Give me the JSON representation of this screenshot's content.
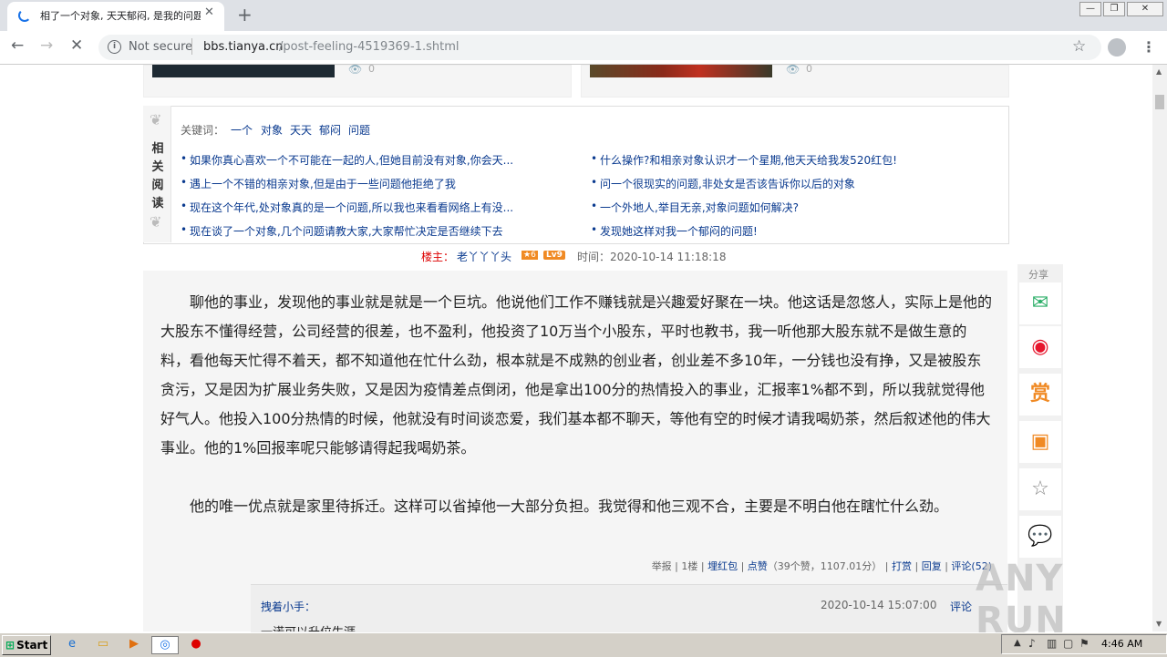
{
  "browser": {
    "tab_title": "相了一个对象, 天天郁闷, 是我的问题",
    "tab_close": "✕",
    "new_tab": "+",
    "not_secure": "Not secure",
    "url_host": "bbs.tianya.cn",
    "url_path": "/post-feeling-4519369-1.shtml"
  },
  "prev_cards": {
    "left_views": "0",
    "right_views": "0"
  },
  "related": {
    "side_title": [
      "相",
      "关",
      "阅",
      "读"
    ],
    "keywords_label": "关键词：",
    "keywords": [
      "一个",
      "对象",
      "天天",
      "郁闷",
      "问题"
    ],
    "left_links": [
      "如果你真心喜欢一个不可能在一起的人,但她目前没有对象,你会天...",
      "遇上一个不错的相亲对象,但是由于一些问题他拒绝了我",
      "现在这个年代,处对象真的是一个问题,所以我也来看看网络上有没...",
      "现在谈了一个对象,几个问题请教大家,大家帮忙决定是否继续下去"
    ],
    "right_links": [
      "什么操作?和相亲对象认识才一个星期,他天天给我发520红包!",
      "问一个很现实的问题,非处女是否该告诉你以后的对象",
      "一个外地人,举目无亲,对象问题如何解决?",
      "发现她这样对我一个郁闷的问题!"
    ]
  },
  "author": {
    "label": "楼主：",
    "name": "老丫丫丫头",
    "badge_star": "★6",
    "badge_level": "Lv9",
    "time": "时间：2020-10-14 11:18:18"
  },
  "post": {
    "paragraph1": "聊他的事业，发现他的事业就是就是一个巨坑。他说他们工作不赚钱就是兴趣爱好聚在一块。他这话是忽悠人，实际上是他的大股东不懂得经营，公司经营的很差，也不盈利，他投资了10万当个小股东，平时也教书，我一听他那大股东就不是做生意的料，看他每天忙得不着天，都不知道他在忙什么劲，根本就是不成熟的创业者，创业差不多10年，一分钱也没有挣，又是被股东贪污，又是因为扩展业务失败，又是因为疫情差点倒闭，他是拿出100分的热情投入的事业，汇报率1%都不到，所以我就觉得他好气人。他投入100分热情的时候，他就没有时间谈恋爱，我们基本都不聊天，等他有空的时候才请我喝奶茶，然后叙述他的伟大事业。他的1%回报率呢只能够请得起我喝奶茶。",
    "paragraph2": "他的唯一优点就是家里待拆迁。这样可以省掉他一大部分负担。我觉得和他三观不合，主要是不明白他在瞎忙什么劲。",
    "report": "举报",
    "floor": "1楼",
    "red_packet": "埋红包",
    "like": "点赞",
    "like_count": "（39个赞，1107.01分）",
    "reward": "打赏",
    "reply": "回复",
    "comment": "评论(52)"
  },
  "reply": {
    "name": "拽着小手：",
    "time": "2020-10-14 15:07:00",
    "comment": "评论",
    "text": "一诺可以升位生涯"
  },
  "share": {
    "label": "分享",
    "reward_char": "赏"
  },
  "watermark": "ANY RUN",
  "taskbar": {
    "start": "Start",
    "clock": "4:46 AM"
  }
}
